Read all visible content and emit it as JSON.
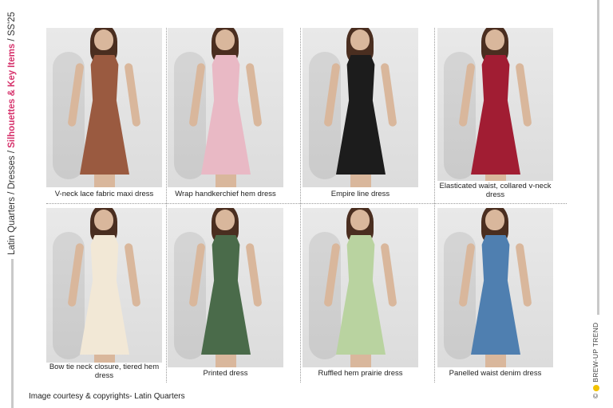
{
  "breadcrumb": {
    "prefix": "Latin Quarters / Dresses / ",
    "highlight": "Silhouettes & Key Items",
    "suffix": " / SS'25"
  },
  "brand": {
    "copyright_symbol": "©",
    "name": "BREW-UP TREND"
  },
  "credit": "Image courtesy & copyrights- Latin Quarters",
  "items": [
    {
      "caption": "V-neck lace fabric maxi dress",
      "color": "#9a5a40"
    },
    {
      "caption": "Wrap handkerchief hem dress",
      "color": "#e9b9c5"
    },
    {
      "caption": "Empire line dress",
      "color": "#1c1c1c"
    },
    {
      "caption": "Elasticated waist, collared v-neck dress",
      "color": "#a11d33"
    },
    {
      "caption": "Bow tie neck closure, tiered hem dress",
      "color": "#f2e8d6"
    },
    {
      "caption": "Printed dress",
      "color": "#4a6b4a"
    },
    {
      "caption": "Ruffled hem prairie dress",
      "color": "#b9d3a0"
    },
    {
      "caption": "Panelled waist denim dress",
      "color": "#4f7fb0"
    }
  ]
}
